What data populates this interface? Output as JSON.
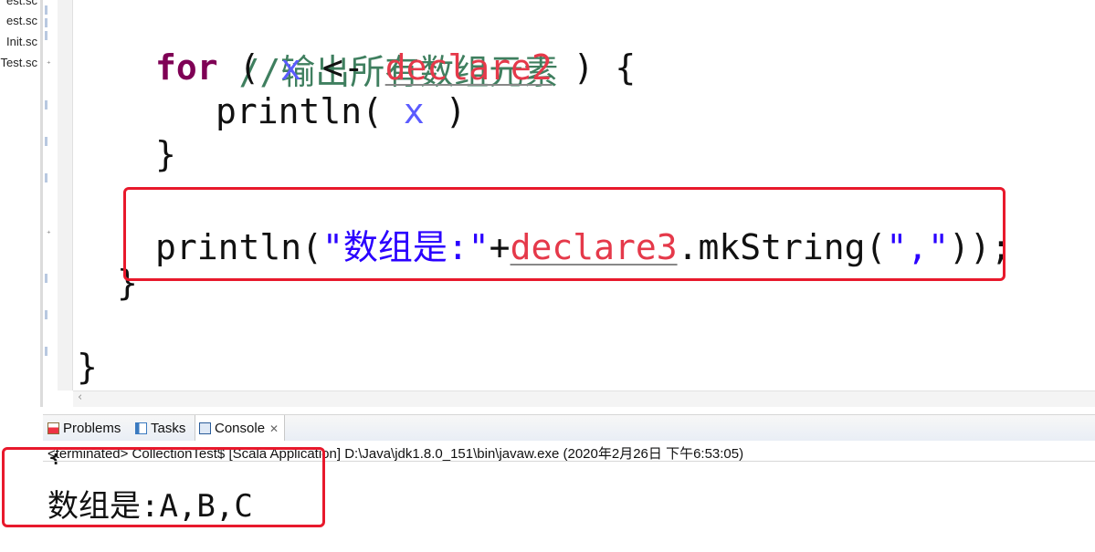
{
  "explorer": {
    "files": [
      "est.sc",
      "est.sc",
      "Init.sc",
      "Test.sc"
    ]
  },
  "editor": {
    "comment": "//输出所有数组元素",
    "for_keyword": "for",
    "for_open": " ( ",
    "loop_var": "x",
    "arrow": " <- ",
    "collection": "declare2",
    "for_close": " ) {",
    "println_open": "println( ",
    "println_arg": "x",
    "println_close": " )",
    "inner_brace": "}",
    "print2_prefix": "println(",
    "print2_string": "\"数组是:\"",
    "print2_plus": "+",
    "print2_ident": "declare3",
    "print2_method": ".mkString(",
    "print2_arg": "\",\"",
    "print2_end": "));",
    "outer_brace": "}",
    "final_brace": "}"
  },
  "panel": {
    "tabs": [
      {
        "label": "Problems",
        "icon": "problems-icon"
      },
      {
        "label": "Tasks",
        "icon": "tasks-icon"
      },
      {
        "label": "Console",
        "icon": "console-icon",
        "close": "✕"
      }
    ],
    "console_status": "<terminated> CollectionTest$ [Scala Application] D:\\Java\\jdk1.8.0_151\\bin\\javaw.exe (2020年2月26日 下午6:53:05)",
    "partial_line": "{",
    "output": "数组是:A,B,C"
  },
  "colors": {
    "annotation": "#e8192c",
    "keyword": "#7f0055",
    "comment": "#3f7f5f",
    "variable": "#5b5bff",
    "error": "#e5394a",
    "string": "#2a00ff"
  }
}
